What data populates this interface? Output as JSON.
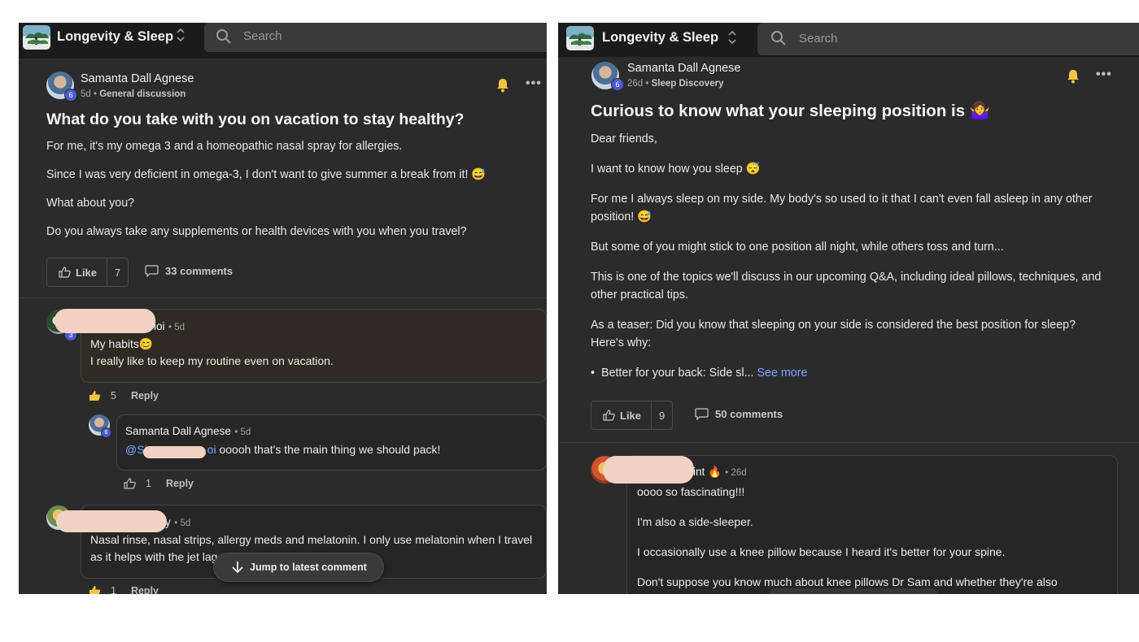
{
  "left": {
    "community": "Longevity & Sleep",
    "search_placeholder": "Search",
    "post": {
      "author": "Samanta Dall Agnese",
      "level": "6",
      "time": "5d",
      "category": "General discussion",
      "title": "What do you take with you on vacation to stay healthy?",
      "paragraphs": [
        "For me, it's my omega 3 and a homeopathic nasal spray for allergies.",
        "Since I was very deficient in omega-3, I don't want to give summer a break from it! 😅",
        "What about you?",
        "Do you always take any supplements or health devices with you when you travel?"
      ],
      "like_label": "Like",
      "like_count": "7",
      "comments_label": "33 comments"
    },
    "comments": [
      {
        "name_tail": "ioi",
        "level": "3",
        "time": "5d",
        "text_line1": "My habits😊",
        "text_line2": "I really like to keep my routine even on vacation.",
        "likes": "5",
        "reply_label": "Reply"
      },
      {
        "name": "Samanta Dall Agnese",
        "level": "6",
        "time": "5d",
        "mention_start": "@Si",
        "mention_end": "oi",
        "text": " ooooh that's the main thing we should pack!",
        "likes": "1",
        "reply_label": "Reply"
      },
      {
        "name_tail": "y",
        "time": "5d",
        "text_line1": "Nasal rinse, nasal strips, allergy meds and melatonin. I only use melatonin when I travel",
        "text_line2": "as it helps with the jet lag",
        "likes": "1",
        "reply_label": "Reply"
      }
    ],
    "jump_label": "Jump to latest comment"
  },
  "right": {
    "community": "Longevity & Sleep",
    "search_placeholder": "Search",
    "post": {
      "author": "Samanta Dall Agnese",
      "level": "6",
      "time": "26d",
      "category": "Sleep Discovery",
      "title": "Curious to know what your sleeping position is 🤷‍♀️",
      "p1": "Dear friends,",
      "p2": "I want to know how you sleep 😴",
      "p3": "For me I always sleep on my side. My body's so used to it that I can't even fall asleep in any other position! 😅",
      "p4": "But some of you might stick to one position all night, while others toss and turn...",
      "p5": "This is one of the topics we'll discuss in our upcoming Q&A, including ideal pillows, techniques, and other practical tips.",
      "p6": "As a teaser: Did you know that sleeping on your side is considered the best position for sleep? Here's why:",
      "bullet": "Better for your back: Side sl...",
      "see_more": "See more",
      "like_label": "Like",
      "like_count": "9",
      "comments_label": "50 comments"
    },
    "comment": {
      "name_tail": "int 🔥",
      "time": "26d",
      "line1": "oooo so fascinating!!!",
      "line2": "I'm also a side-sleeper.",
      "line3": "I occasionally use a knee pillow because I heard it's better for your spine.",
      "line4": "Don't suppose you know much about knee pillows Dr Sam and whether they're also"
    }
  }
}
